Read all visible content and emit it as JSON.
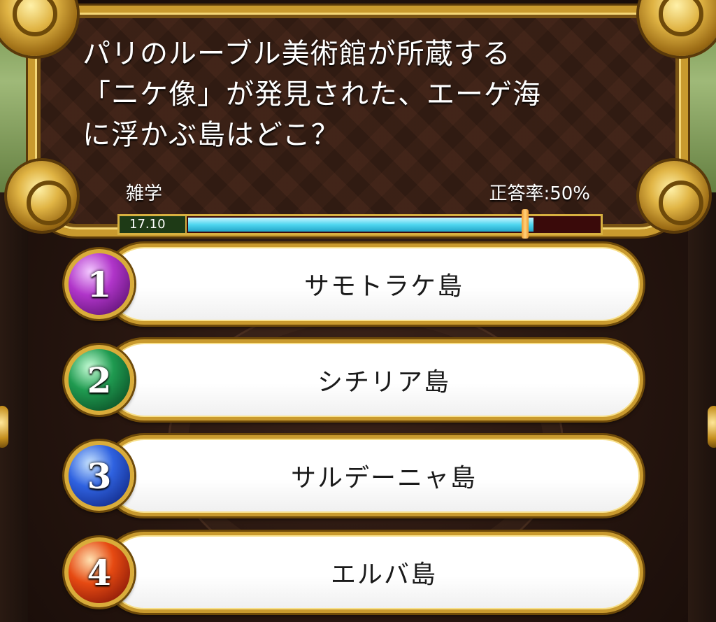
{
  "question": {
    "text": "パリのルーブル美術館が所蔵する\n「ニケ像」が発見された、エーゲ海\nに浮かぶ島はどこ？",
    "genre": "雑学",
    "correct_rate": "正答率:50%"
  },
  "timer": {
    "value": "17.10",
    "fraction_remaining": 0.84,
    "marker_fraction": 0.82
  },
  "answers": [
    {
      "number": "1",
      "label": "サモトラケ島",
      "color": "#b035c9"
    },
    {
      "number": "2",
      "label": "シチリア島",
      "color": "#1f9a50"
    },
    {
      "number": "3",
      "label": "サルデーニャ島",
      "color": "#2f62e0"
    },
    {
      "number": "4",
      "label": "エルバ島",
      "color": "#e64a12"
    }
  ],
  "colors": {
    "frame_gold": "#c99a2e",
    "timer_fill": "#4fd6f0",
    "timer_track": "#3a0a0a"
  }
}
